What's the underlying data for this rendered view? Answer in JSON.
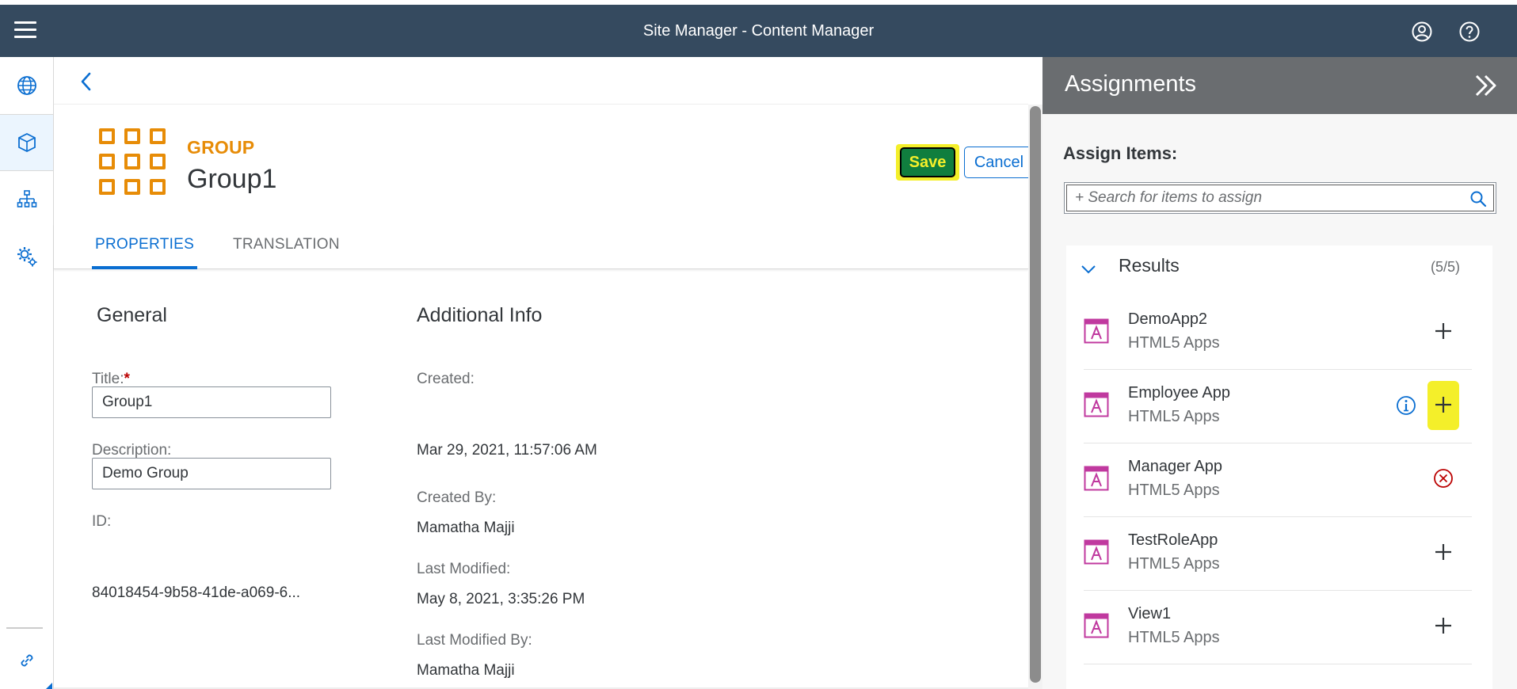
{
  "shell": {
    "title": "Site Manager - Content Manager"
  },
  "object": {
    "type_label": "GROUP",
    "name": "Group1",
    "save_label": "Save",
    "cancel_label": "Cancel"
  },
  "tabs": [
    {
      "label": "PROPERTIES",
      "active": true
    },
    {
      "label": "TRANSLATION",
      "active": false
    }
  ],
  "general": {
    "heading": "General",
    "title_label": "Title:",
    "required_mark": "*",
    "title_value": "Group1",
    "description_label": "Description:",
    "description_value": "Demo Group",
    "id_label": "ID:",
    "id_value": "84018454-9b58-41de-a069-6..."
  },
  "additional": {
    "heading": "Additional Info",
    "created_label": "Created:",
    "created_value": "Mar 29, 2021, 11:57:06 AM",
    "created_by_label": "Created By:",
    "created_by_value": "Mamatha Majji",
    "modified_label": "Last Modified:",
    "modified_value": "May 8, 2021, 3:35:26 PM",
    "modified_by_label": "Last Modified By:",
    "modified_by_value": "Mamatha Majji"
  },
  "assignments": {
    "title": "Assignments",
    "assign_label": "Assign Items:",
    "search_placeholder": "+ Search for items to assign",
    "results_title": "Results",
    "results_count": "(5/5)",
    "items": [
      {
        "name": "DemoApp2",
        "type": "HTML5 Apps",
        "action": "add"
      },
      {
        "name": "Employee App",
        "type": "HTML5 Apps",
        "action": "add-highlighted"
      },
      {
        "name": "Manager App",
        "type": "HTML5 Apps",
        "action": "remove"
      },
      {
        "name": "TestRoleApp",
        "type": "HTML5 Apps",
        "action": "add"
      },
      {
        "name": "View1",
        "type": "HTML5 Apps",
        "action": "add"
      }
    ]
  },
  "colors": {
    "shell": "#354a5f",
    "accent": "#0a6ed1",
    "group_orange": "#e78c07",
    "save_green": "#107e3e",
    "highlight": "#f4ef2a",
    "app_icon": "#c0399f",
    "remove_red": "#bb0000"
  }
}
